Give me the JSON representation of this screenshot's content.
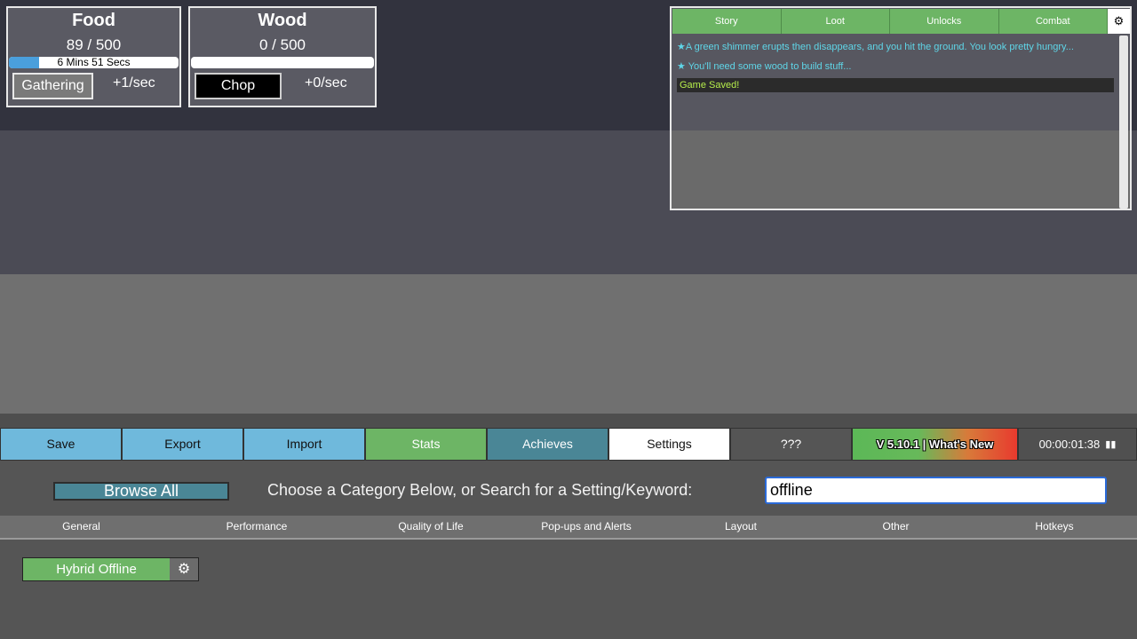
{
  "resources": {
    "food": {
      "title": "Food",
      "amount": "89 / 500",
      "timer": "6 Mins 51 Secs",
      "progress": 0.18,
      "button": "Gathering",
      "rate": "+1/sec"
    },
    "wood": {
      "title": "Wood",
      "amount": "0 / 500",
      "progress": 0.0,
      "button": "Chop",
      "rate": "+0/sec"
    }
  },
  "log": {
    "tabs": [
      "Story",
      "Loot",
      "Unlocks",
      "Combat"
    ],
    "gear_icon": "gear-icon",
    "messages": [
      "★A green shimmer erupts then disappears, and you hit the ground. You look pretty hungry...",
      "★ You'll need some wood to build stuff..."
    ],
    "saved": "Game Saved!"
  },
  "menu": {
    "save": "Save",
    "export": "Export",
    "import": "Import",
    "stats": "Stats",
    "achieves": "Achieves",
    "settings": "Settings",
    "unknown": "???",
    "version": "V 5.10.1 | What's New",
    "clock": "00:00:01:38",
    "pause_icon": "pause-icon"
  },
  "settings_panel": {
    "browse_all": "Browse All",
    "prompt": "Choose a Category Below, or Search for a Setting/Keyword:",
    "search_value": "offline",
    "categories": [
      "General",
      "Performance",
      "Quality of Life",
      "Pop-ups and Alerts",
      "Layout",
      "Other",
      "Hotkeys"
    ],
    "results": [
      {
        "label": "Hybrid Offline",
        "icon": "gear-icon"
      }
    ]
  },
  "colors": {
    "accent_green": "#6db565",
    "accent_blue": "#6fb9dc",
    "accent_teal": "#4a8696",
    "log_text": "#5fd6e8",
    "saved_text": "#b6ee4c"
  }
}
